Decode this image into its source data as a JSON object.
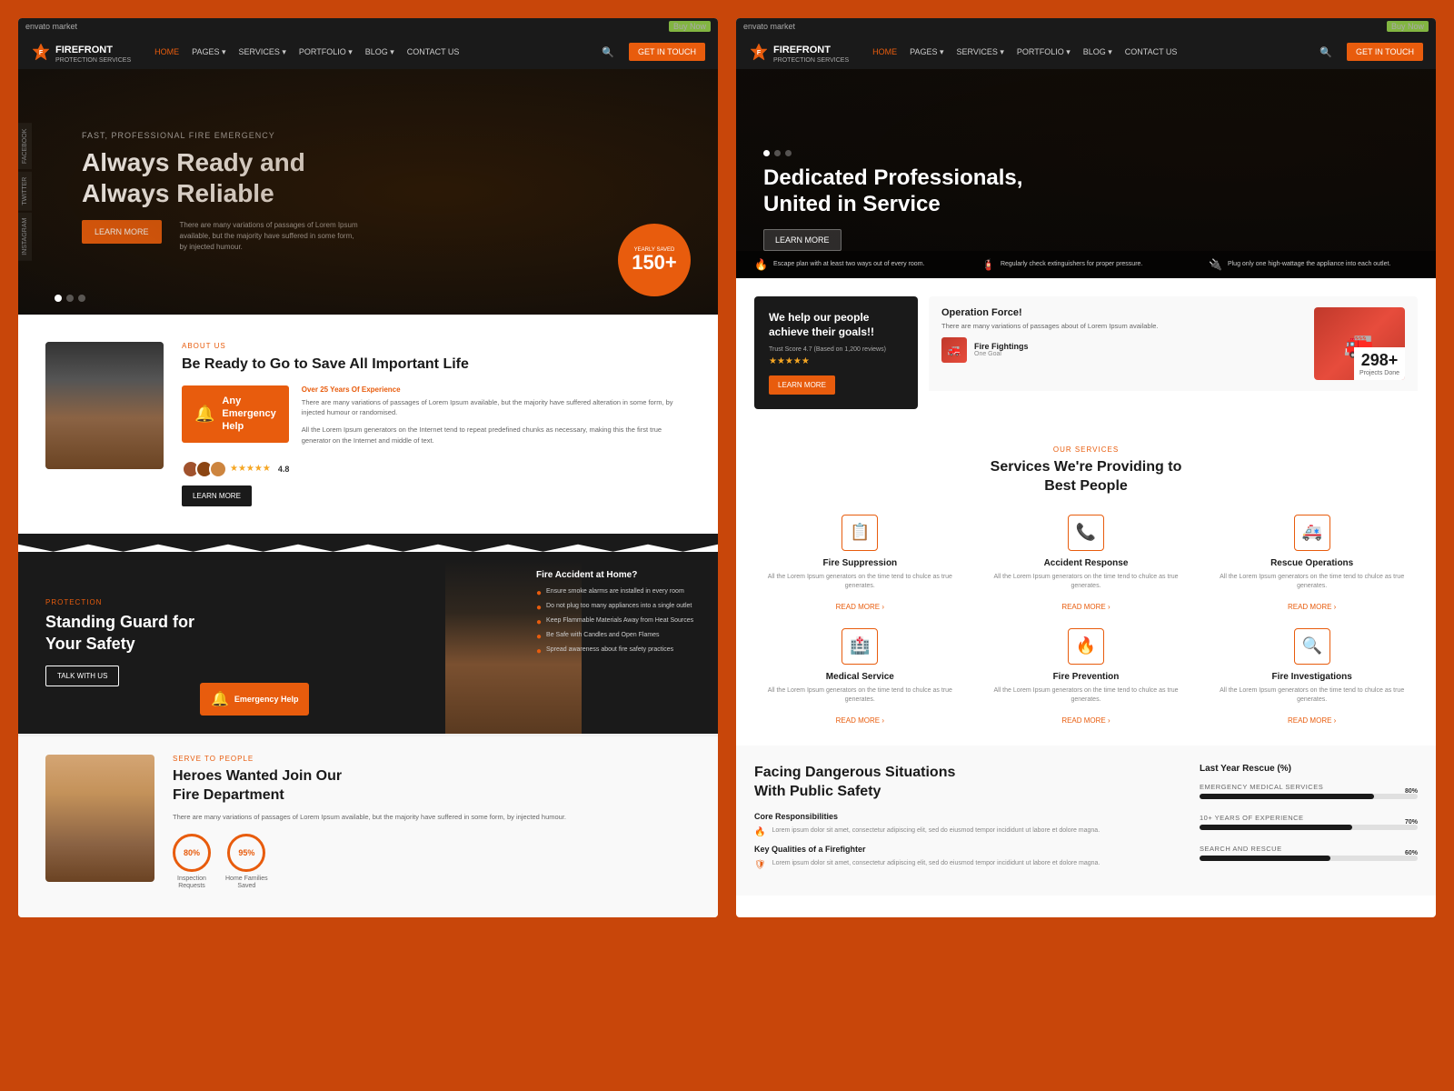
{
  "meta": {
    "envato_label": "envato market",
    "envato_btn": "Buy Now"
  },
  "brand": {
    "name": "FIREFRONT",
    "tagline": "PROTECTION SERVICES",
    "shield_color": "#e85c0d"
  },
  "nav": {
    "links": [
      "HOME",
      "PAGES",
      "SERVICES",
      "PORTFOLIO",
      "BLOG",
      "CONTACT US"
    ],
    "cta": "GET IN TOUCH"
  },
  "hero_left": {
    "sub_label": "FAST, PROFESSIONAL FIRE EMERGENCY",
    "title_line1": "Always Ready and",
    "title_line2": "Always Reliable",
    "cta": "LEARN MORE",
    "desc": "There are many variations of passages of Lorem Ipsum available, but the majority have suffered in some form, by injected humour.",
    "stat_label": "YEARLY SAVED",
    "stat_num": "150",
    "stat_plus": "+"
  },
  "about": {
    "label": "ABOUT US",
    "title": "Be Ready to Go to Save All Important Life",
    "emergency_card": {
      "icon": "🔔",
      "line1": "Any Emergency",
      "line2": "Help"
    },
    "exp_label": "Over 25 Years Of Experience",
    "exp_desc": "There are many variations of passages of Lorem Ipsum available, but the majority have suffered alteration in some form, by injected humour or randomised.",
    "desc2": "All the Lorem Ipsum generators on the Internet tend to repeat predefined chunks as necessary, making this the first true generator on the Internet and middle of text.",
    "rating": "4.8",
    "cta": "LEARN MORE"
  },
  "protection": {
    "label": "PROTECTION",
    "title_line1": "Standing Guard for",
    "title_line2": "Your Safety",
    "cta": "TALK WITH US",
    "fire_accident": {
      "title": "Fire Accident at Home?",
      "tips": [
        "Ensure smoke alarms are installed in every room",
        "Do not plug too many appliances into a single outlet",
        "Keep Flammable Materials Away from Heat Sources",
        "Be Safe with Candles and Open Flames",
        "Spread awareness about fire safety practices"
      ]
    },
    "emergency_badge": {
      "icon": "🔔",
      "text": "Emergency Help"
    }
  },
  "recruit": {
    "label": "SERVE TO PEOPLE",
    "title_line1": "Heroes Wanted Join Our",
    "title_line2": "Fire Department",
    "desc": "There are many variations of passages of Lorem Ipsum available, but the majority have suffered in some form, by injected humour.",
    "stats": [
      {
        "value": "80%",
        "label": "Inspection\nRequests"
      },
      {
        "value": "95%",
        "label": "Home Families\nSaved"
      }
    ]
  },
  "hero_right": {
    "title_line1": "Dedicated Professionals,",
    "title_line2": "United in Service",
    "cta": "LEARN MORE",
    "tips": [
      "Escape plan with at least two ways out of every room.",
      "Regularly check extinguishers for proper pressure.",
      "Plug only one high-wattage the appliance into each outlet."
    ]
  },
  "operation": {
    "dark_card": {
      "title": "We help our people achieve their goals!!",
      "trust_label": "Trust Score 4.7 (Based on 1,200 reviews)",
      "cta": "LEARN MORE"
    },
    "light_card": {
      "title": "Operation Force!",
      "desc": "There are many variations of passages about of Lorem Ipsum available.",
      "service1": "Fire Fightings",
      "service1_sub": "One Goal",
      "stat_num": "298+",
      "stat_label": "Projects Done"
    }
  },
  "services": {
    "label": "OUR SERVICES",
    "title_line1": "Services We're Providing to",
    "title_line2": "Best People",
    "items": [
      {
        "icon": "📋",
        "name": "Fire Suppression",
        "desc": "All the Lorem Ipsum generators on the time tend to chulce as true generates.",
        "read_more": "READ MORE"
      },
      {
        "icon": "📞",
        "name": "Accident Response",
        "desc": "All the Lorem Ipsum generators on the time tend to chulce as true generates.",
        "read_more": "READ MORE"
      },
      {
        "icon": "🚑",
        "name": "Rescue Operations",
        "desc": "All the Lorem Ipsum generators on the time tend to chulce as true generates.",
        "read_more": "READ MORE"
      },
      {
        "icon": "🏥",
        "name": "Medical Service",
        "desc": "All the Lorem Ipsum generators on the time tend to chulce as true generates.",
        "read_more": "READ MORE"
      },
      {
        "icon": "🔥",
        "name": "Fire Prevention",
        "desc": "All the Lorem Ipsum generators on the time tend to chulce as true generates.",
        "read_more": "READ MORE"
      },
      {
        "icon": "🔍",
        "name": "Fire Investigations",
        "desc": "All the Lorem Ipsum generators on the time tend to chulce as true generates.",
        "read_more": "READ MORE"
      }
    ]
  },
  "public_safety": {
    "title_line1": "Facing Dangerous Situations",
    "title_line2": "With Public Safety",
    "responsibilities": {
      "title": "Core Responsibilities",
      "items": [
        {
          "icon": "🔥",
          "name": "",
          "desc": "Lorem ipsum dolor sit amet, consectetur adipiscing elit, sed do eiusmod tempor incididunt ut labore et dolore magna."
        }
      ]
    },
    "qualities": {
      "title": "Key Qualities of a Firefighter",
      "items": [
        {
          "icon": "🛡",
          "name": "",
          "desc": "Lorem ipsum dolor sit amet, consectetur adipiscing elit, sed do eiusmod tempor incididunt ut labore et dolore magna."
        }
      ]
    },
    "rescue": {
      "title": "Last Year Rescue (%)",
      "bars": [
        {
          "label": "EMERGENCY MEDICAL SERVICES",
          "pct": 80
        },
        {
          "label": "10+ YEARS OF EXPERIENCE",
          "pct": 70
        },
        {
          "label": "SEARCH AND RESCUE",
          "pct": 60
        }
      ]
    }
  }
}
